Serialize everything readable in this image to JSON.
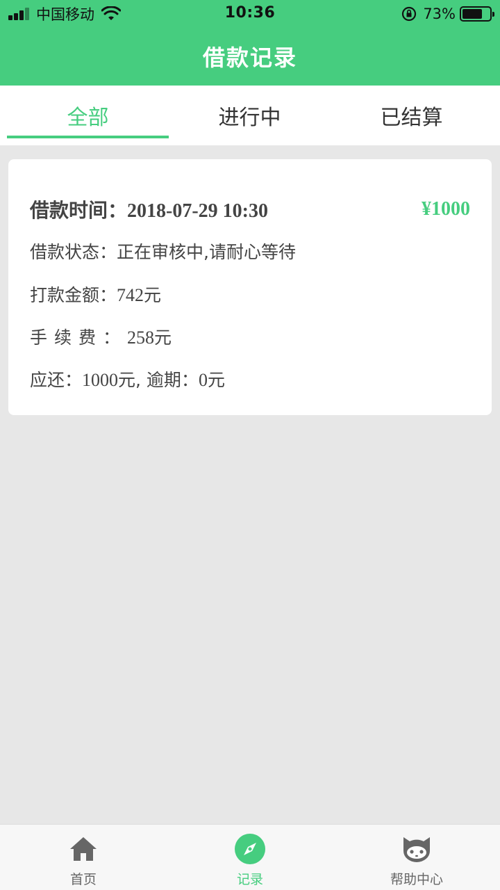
{
  "status_bar": {
    "carrier": "中国移动",
    "time": "10:36",
    "battery_percent": "73%",
    "battery_level": 0.73
  },
  "header": {
    "title": "借款记录"
  },
  "tabs": [
    {
      "label": "全部",
      "active": true
    },
    {
      "label": "进行中",
      "active": false
    },
    {
      "label": "已结算",
      "active": false
    }
  ],
  "record": {
    "time_label": "借款时间：",
    "time_value": "2018-07-29 10:30",
    "amount": "¥1000",
    "status_label": "借款状态：",
    "status_value": "正在审核中,请耐心等待",
    "payout_label": "打款金额：",
    "payout_value": "742",
    "payout_unit": "元",
    "fee_label": "手续费：",
    "fee_value": "258",
    "fee_unit": "元",
    "due_label": "应还：",
    "due_value": "1000",
    "due_unit": "元,",
    "overdue_label": "逾期：",
    "overdue_value": "0",
    "overdue_unit": "元"
  },
  "bottom_nav": [
    {
      "label": "首页",
      "icon": "home-icon",
      "active": false
    },
    {
      "label": "记录",
      "icon": "compass-icon",
      "active": true
    },
    {
      "label": "帮助中心",
      "icon": "cat-icon",
      "active": false
    }
  ],
  "colors": {
    "accent": "#46cd7f",
    "background": "#e7e7e7",
    "card": "#ffffff"
  }
}
